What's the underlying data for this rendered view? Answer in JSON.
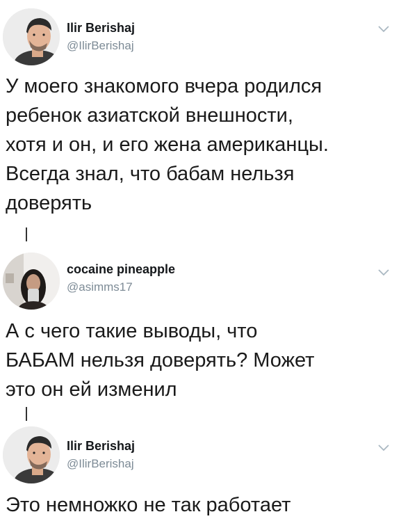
{
  "tweets": [
    {
      "name": "Ilir Berishaj",
      "handle": "@IlirBerishaj",
      "text": "У моего знакомого вчера родился\nребенок азиатской внешности,\nхотя и он, и его жена американцы.\nВсегда знал, что бабам нельзя\nдоверять",
      "avatar_icon": "profile-photo-man-icon",
      "menu_icon": "chevron-down-icon"
    },
    {
      "name": "cocaine pineapple",
      "handle": "@asimms17",
      "text": "А с чего такие выводы, что\nБАБАМ нельзя доверять? Может\nэто он ей изменил",
      "avatar_icon": "profile-photo-woman-icon",
      "menu_icon": "chevron-down-icon"
    },
    {
      "name": "Ilir Berishaj",
      "handle": "@IlirBerishaj",
      "text": "Это немножко не так работает",
      "avatar_icon": "profile-photo-man-icon",
      "menu_icon": "chevron-down-icon"
    }
  ],
  "colors": {
    "name": "#14171a",
    "handle": "#7d8b96",
    "text": "#1a1a1a",
    "thread_line": "#333333",
    "chevron": "#aab8c2"
  }
}
